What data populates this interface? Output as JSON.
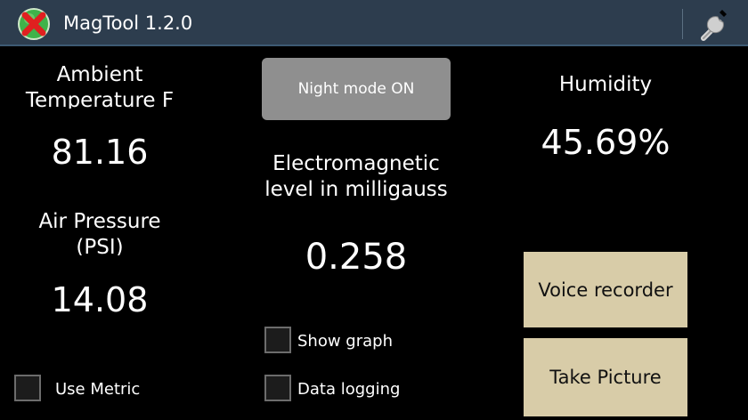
{
  "actionbar": {
    "title": "MagTool 1.2.0",
    "icon": "app-logo-red-x-icon",
    "settings_icon": "wrench-icon"
  },
  "temperature": {
    "label_line1": "Ambient",
    "label_line2": "Temperature F",
    "value": "81.16"
  },
  "pressure": {
    "label_line1": "Air Pressure",
    "label_line2": "(PSI)",
    "value": "14.08"
  },
  "night_mode": {
    "label": "Night mode ON"
  },
  "em": {
    "label_line1": "Electromagnetic",
    "label_line2": "level in milligauss",
    "value": "0.258"
  },
  "humidity": {
    "label": "Humidity",
    "value": "45.69%"
  },
  "buttons": {
    "voice_recorder": "Voice recorder",
    "take_picture": "Take Picture"
  },
  "checkboxes": {
    "use_metric": {
      "label": "Use Metric",
      "checked": false
    },
    "show_graph": {
      "label": "Show graph",
      "checked": false
    },
    "data_logging": {
      "label": "Data logging",
      "checked": false
    }
  },
  "colors": {
    "actionbar_bg": "#2d3d4e",
    "night_button_bg": "#8f8f8f",
    "action_button_bg": "#d8cca8"
  }
}
